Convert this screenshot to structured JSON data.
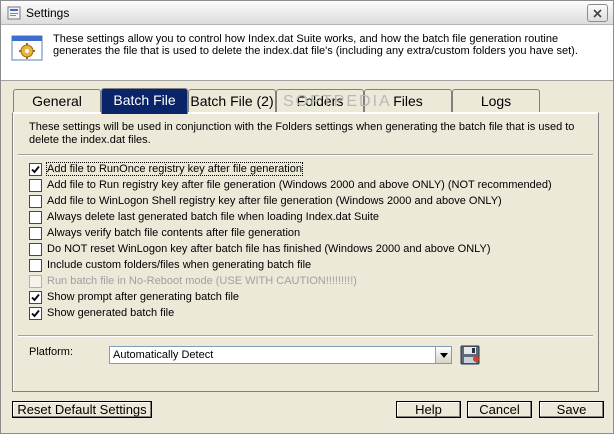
{
  "window": {
    "title": "Settings"
  },
  "header": {
    "text": "These settings allow you to control how Index.dat Suite works, and how the batch file generation routine generates the file that is used to delete the index.dat file's (including any extra/custom folders you have set)."
  },
  "tabs": [
    {
      "label": "General",
      "active": false
    },
    {
      "label": "Batch File",
      "active": true
    },
    {
      "label": "Batch File (2)",
      "active": false
    },
    {
      "label": "Folders",
      "active": false
    },
    {
      "label": "Files",
      "active": false
    },
    {
      "label": "Logs",
      "active": false
    }
  ],
  "watermark": "SOFTPEDIA",
  "panel": {
    "description": "These settings will be used in conjunction with the Folders settings when generating the batch file that is used to delete the index.dat files.",
    "options": [
      {
        "label": "Add file to RunOnce registry key after file generation",
        "checked": true,
        "enabled": true
      },
      {
        "label": "Add file to Run registry key after file generation (Windows 2000 and above ONLY) (NOT recommended)",
        "checked": false,
        "enabled": true
      },
      {
        "label": "Add file to WinLogon Shell registry key after file generation (Windows 2000 and above ONLY)",
        "checked": false,
        "enabled": true
      },
      {
        "label": "Always delete last generated batch file when loading Index.dat Suite",
        "checked": false,
        "enabled": true
      },
      {
        "label": "Always verify batch file contents after file generation",
        "checked": false,
        "enabled": true
      },
      {
        "label": "Do NOT reset WinLogon key after batch file has finished (Windows 2000 and above ONLY)",
        "checked": false,
        "enabled": true
      },
      {
        "label": "Include custom folders/files when generating batch file",
        "checked": false,
        "enabled": true
      },
      {
        "label": "Run batch file in No-Reboot mode (USE WITH CAUTION!!!!!!!!!)",
        "checked": false,
        "enabled": false
      },
      {
        "label": "Show prompt after generating batch file",
        "checked": true,
        "enabled": true
      },
      {
        "label": "Show generated batch file",
        "checked": true,
        "enabled": true
      }
    ],
    "platform_label": "Platform:",
    "platform_value": "Automatically Detect"
  },
  "buttons": {
    "reset": "Reset Default Settings",
    "help": "Help",
    "cancel": "Cancel",
    "save": "Save"
  }
}
